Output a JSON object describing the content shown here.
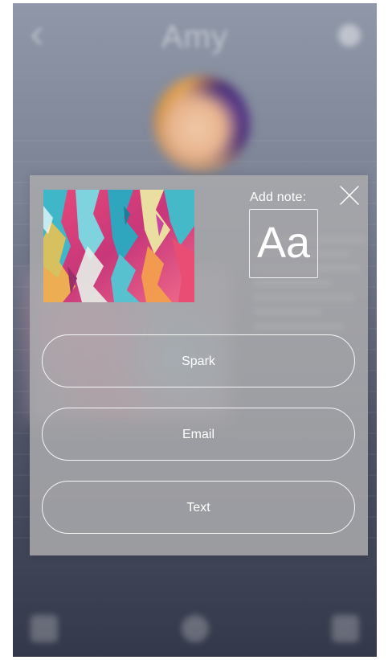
{
  "profile": {
    "name": "Amy"
  },
  "modal": {
    "note_label": "Add note:",
    "note_button_label": "Aa",
    "buttons": [
      {
        "label": "Spark"
      },
      {
        "label": "Email"
      },
      {
        "label": "Text"
      }
    ]
  },
  "colors": {
    "modal_background": "#aaaaac",
    "button_border": "#ffffff",
    "text": "#ffffff"
  },
  "icons": [
    "back-arrow-icon",
    "gear-icon",
    "close-icon",
    "bottom-left-icon",
    "bottom-center-icon",
    "bottom-right-icon"
  ]
}
